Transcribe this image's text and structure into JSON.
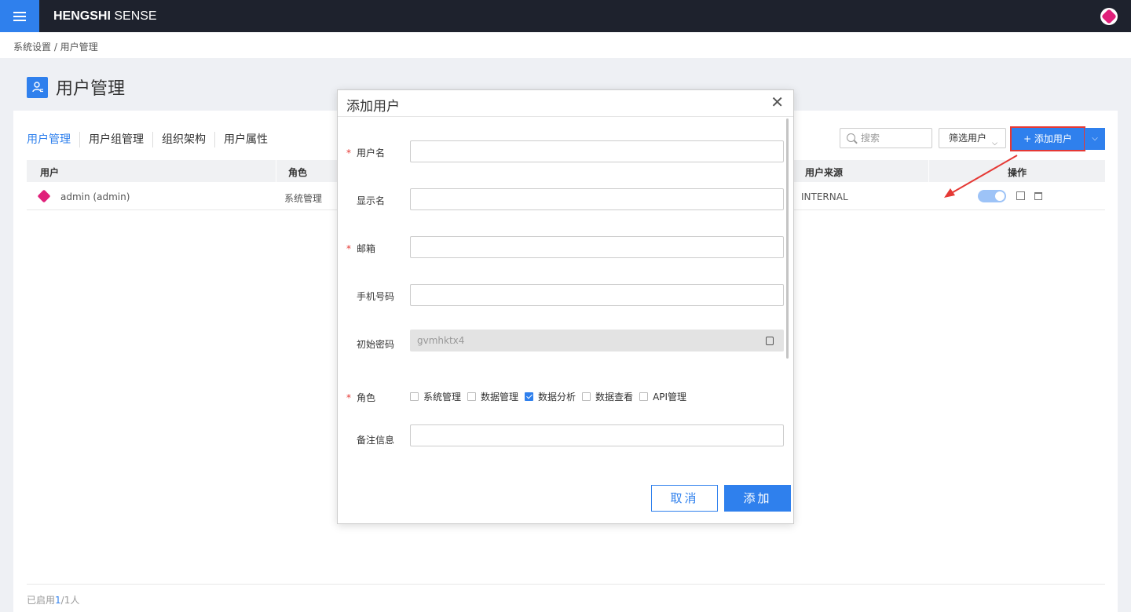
{
  "app": {
    "brand_bold": "HENGSHI",
    "brand_light": " SENSE"
  },
  "breadcrumb": "系统设置 / 用户管理",
  "page": {
    "title": "用户管理"
  },
  "tabs": [
    "用户管理",
    "用户组管理",
    "组织架构",
    "用户属性"
  ],
  "toolbar": {
    "search_placeholder": "搜索",
    "filter_label": "筛选用户",
    "add_label": "+ 添加用户"
  },
  "table": {
    "headers": {
      "user": "用户",
      "role": "角色",
      "source": "用户来源",
      "actions": "操作"
    },
    "rows": [
      {
        "user": "admin (admin)",
        "role": "系统管理",
        "source": "INTERNAL",
        "enabled": true
      }
    ]
  },
  "footer": {
    "prefix": "已启用",
    "count": "1",
    "suffix": "/1人"
  },
  "modal": {
    "title": "添加用户",
    "fields": {
      "username": "用户名",
      "display_name": "显示名",
      "email": "邮箱",
      "phone": "手机号码",
      "init_password": "初始密码",
      "init_password_value": "gvmhktx4",
      "role": "角色",
      "note": "备注信息"
    },
    "roles": [
      {
        "label": "系统管理",
        "checked": false
      },
      {
        "label": "数据管理",
        "checked": false
      },
      {
        "label": "数据分析",
        "checked": true
      },
      {
        "label": "数据查看",
        "checked": false
      },
      {
        "label": "API管理",
        "checked": false
      }
    ],
    "cancel_label": "取消",
    "add_label": "添加"
  },
  "colors": {
    "accent": "#2f80ed",
    "topbar": "#1e222d",
    "highlight": "#e53935",
    "brand_pink": "#e0207a"
  }
}
